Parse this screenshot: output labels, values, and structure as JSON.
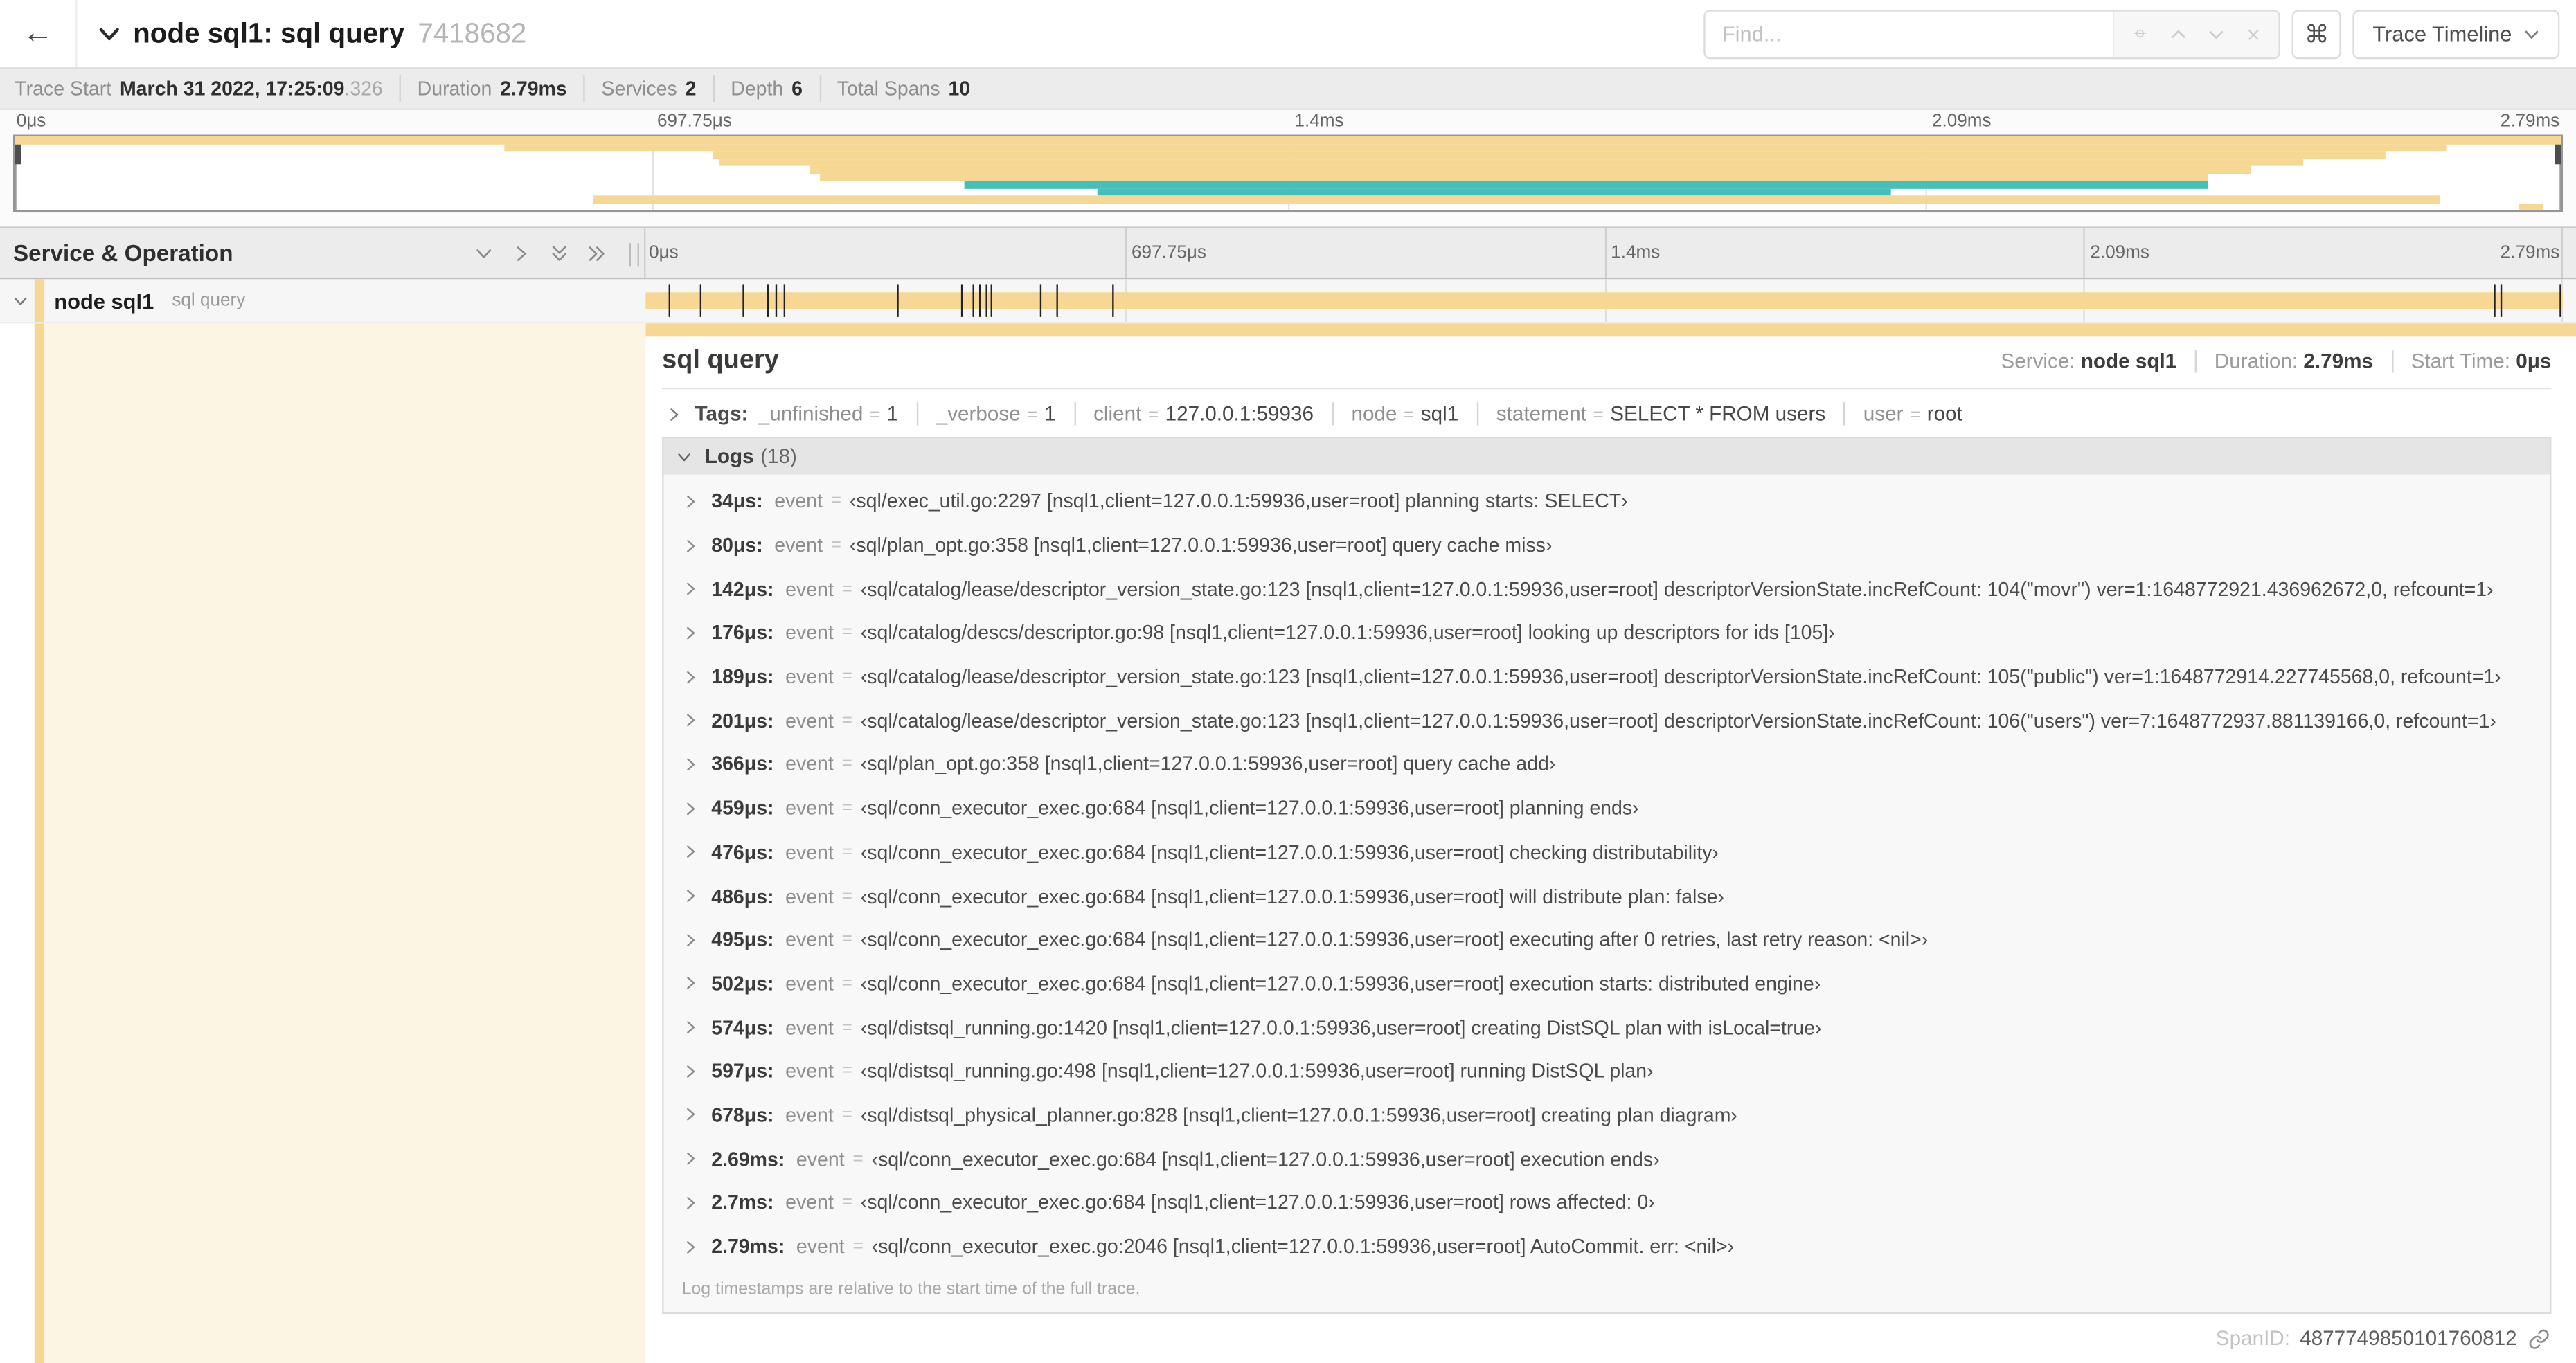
{
  "colors": {
    "tan": "#F6D794",
    "teal": "#44C0BB",
    "cream": "#FCF5E3",
    "tick": "#222222"
  },
  "header": {
    "back_icon": "←",
    "title": "node sql1: sql query",
    "trace_id_short": "7418682",
    "find_placeholder": "Find...",
    "locate_icon": "⌖",
    "clear_icon": "×",
    "keyboard_shortcut_icon": "⌘",
    "view_dropdown_label": "Trace Timeline"
  },
  "trace_meta": {
    "trace_start_label": "Trace Start",
    "trace_start_value": "March 31 2022, 17:25:09",
    "trace_start_fraction": ".326",
    "duration_label": "Duration",
    "duration_value": "2.79ms",
    "services_label": "Services",
    "services_value": "2",
    "depth_label": "Depth",
    "depth_value": "6",
    "total_spans_label": "Total Spans",
    "total_spans_value": "10"
  },
  "minimap": {
    "ticks": [
      "0μs",
      "697.75μs",
      "1.4ms",
      "2.09ms",
      "2.79ms"
    ],
    "spans": [
      {
        "row": 0,
        "start": 0.0,
        "end": 1.0,
        "color": "tan"
      },
      {
        "row": 1,
        "start": 0.192,
        "end": 0.955,
        "color": "tan"
      },
      {
        "row": 2,
        "start": 0.274,
        "end": 0.931,
        "color": "tan"
      },
      {
        "row": 3,
        "start": 0.277,
        "end": 0.899,
        "color": "tan"
      },
      {
        "row": 4,
        "start": 0.312,
        "end": 0.878,
        "color": "tan"
      },
      {
        "row": 5,
        "start": 0.316,
        "end": 0.861,
        "color": "tan"
      },
      {
        "row": 6,
        "start": 0.373,
        "end": 0.861,
        "color": "teal"
      },
      {
        "row": 7,
        "start": 0.425,
        "end": 0.737,
        "color": "teal"
      },
      {
        "row": 8,
        "start": 0.227,
        "end": 0.952,
        "color": "tan"
      },
      {
        "row": 9,
        "start": 0.983,
        "end": 0.993,
        "color": "tan"
      }
    ]
  },
  "timeline": {
    "column_header": "Service & Operation",
    "ruler_ticks": [
      "0μs",
      "697.75μs",
      "1.4ms",
      "2.09ms",
      "2.79ms"
    ],
    "row": {
      "service": "node sql1",
      "operation": "sql query",
      "bar_start": 0.0,
      "bar_end": 1.0,
      "log_tick_fractions": [
        0.0122,
        0.0287,
        0.0509,
        0.0631,
        0.0677,
        0.072,
        0.1312,
        0.1645,
        0.1706,
        0.1742,
        0.1774,
        0.18,
        0.2057,
        0.214,
        0.243,
        0.9642,
        0.9677,
        0.998
      ]
    }
  },
  "detail": {
    "title": "sql query",
    "service_label": "Service:",
    "service_value": "node sql1",
    "duration_label": "Duration:",
    "duration_value": "2.79ms",
    "start_time_label": "Start Time:",
    "start_time_value": "0μs",
    "tags_label": "Tags:",
    "tags": [
      {
        "key": "_unfinished",
        "value": "1"
      },
      {
        "key": "_verbose",
        "value": "1"
      },
      {
        "key": "client",
        "value": "127.0.0.1:59936"
      },
      {
        "key": "node",
        "value": "sql1"
      },
      {
        "key": "statement",
        "value": "SELECT * FROM users"
      },
      {
        "key": "user",
        "value": "root"
      }
    ],
    "logs_label": "Logs",
    "logs_count": "(18)",
    "log_field_label": "event",
    "logs": [
      {
        "time": "34μs:",
        "value": "‹sql/exec_util.go:2297 [nsql1,client=127.0.0.1:59936,user=root] planning starts: SELECT›"
      },
      {
        "time": "80μs:",
        "value": "‹sql/plan_opt.go:358 [nsql1,client=127.0.0.1:59936,user=root] query cache miss›"
      },
      {
        "time": "142μs:",
        "value": "‹sql/catalog/lease/descriptor_version_state.go:123 [nsql1,client=127.0.0.1:59936,user=root] descriptorVersionState.incRefCount: 104(\"movr\") ver=1:1648772921.436962672,0, refcount=1›"
      },
      {
        "time": "176μs:",
        "value": "‹sql/catalog/descs/descriptor.go:98 [nsql1,client=127.0.0.1:59936,user=root] looking up descriptors for ids [105]›"
      },
      {
        "time": "189μs:",
        "value": "‹sql/catalog/lease/descriptor_version_state.go:123 [nsql1,client=127.0.0.1:59936,user=root] descriptorVersionState.incRefCount: 105(\"public\") ver=1:1648772914.227745568,0, refcount=1›"
      },
      {
        "time": "201μs:",
        "value": "‹sql/catalog/lease/descriptor_version_state.go:123 [nsql1,client=127.0.0.1:59936,user=root] descriptorVersionState.incRefCount: 106(\"users\") ver=7:1648772937.881139166,0, refcount=1›"
      },
      {
        "time": "366μs:",
        "value": "‹sql/plan_opt.go:358 [nsql1,client=127.0.0.1:59936,user=root] query cache add›"
      },
      {
        "time": "459μs:",
        "value": "‹sql/conn_executor_exec.go:684 [nsql1,client=127.0.0.1:59936,user=root] planning ends›"
      },
      {
        "time": "476μs:",
        "value": "‹sql/conn_executor_exec.go:684 [nsql1,client=127.0.0.1:59936,user=root] checking distributability›"
      },
      {
        "time": "486μs:",
        "value": "‹sql/conn_executor_exec.go:684 [nsql1,client=127.0.0.1:59936,user=root] will distribute plan: false›"
      },
      {
        "time": "495μs:",
        "value": "‹sql/conn_executor_exec.go:684 [nsql1,client=127.0.0.1:59936,user=root] executing after 0 retries, last retry reason: <nil>›"
      },
      {
        "time": "502μs:",
        "value": "‹sql/conn_executor_exec.go:684 [nsql1,client=127.0.0.1:59936,user=root] execution starts: distributed engine›"
      },
      {
        "time": "574μs:",
        "value": "‹sql/distsql_running.go:1420 [nsql1,client=127.0.0.1:59936,user=root] creating DistSQL plan with isLocal=true›"
      },
      {
        "time": "597μs:",
        "value": "‹sql/distsql_running.go:498 [nsql1,client=127.0.0.1:59936,user=root] running DistSQL plan›"
      },
      {
        "time": "678μs:",
        "value": "‹sql/distsql_physical_planner.go:828 [nsql1,client=127.0.0.1:59936,user=root] creating plan diagram›"
      },
      {
        "time": "2.69ms:",
        "value": "‹sql/conn_executor_exec.go:684 [nsql1,client=127.0.0.1:59936,user=root] execution ends›"
      },
      {
        "time": "2.7ms:",
        "value": "‹sql/conn_executor_exec.go:684 [nsql1,client=127.0.0.1:59936,user=root] rows affected: 0›"
      },
      {
        "time": "2.79ms:",
        "value": "‹sql/conn_executor_exec.go:2046 [nsql1,client=127.0.0.1:59936,user=root] AutoCommit. err: <nil>›"
      }
    ],
    "logs_footnote": "Log timestamps are relative to the start time of the full trace.",
    "span_id_label": "SpanID:",
    "span_id_value": "4877749850101760812"
  }
}
